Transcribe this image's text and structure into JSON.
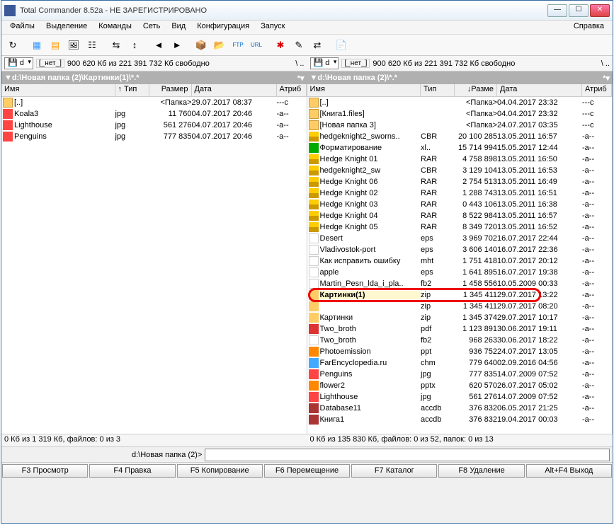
{
  "title": "Total Commander 8.52a - НЕ ЗАРЕГИСТРИРОВАНО",
  "menu": [
    "Файлы",
    "Выделение",
    "Команды",
    "Сеть",
    "Вид",
    "Конфигурация",
    "Запуск"
  ],
  "menu_right": "Справка",
  "drive": {
    "left": {
      "sel": "d",
      "label": "[_нет_]",
      "space": "900 620 Кб из 221 391 732 Кб свободно",
      "nav": "\\  ..",
      "path": "▼d:\\Новая папка (2)\\Картинки(1)\\*.*"
    },
    "right": {
      "sel": "d",
      "label": "[_нет_]",
      "space": "900 620 Кб из 221 391 732 Кб свободно",
      "nav": "\\  ..",
      "path": "▼d:\\Новая папка (2)\\*.*"
    }
  },
  "colhdr": {
    "name": "Имя",
    "type": "↑ Тип",
    "size": "Размер",
    "date": "Дата",
    "attr": "Атриб"
  },
  "colhdr_r": {
    "name": "Имя",
    "type": "Тип",
    "size": "↓Разме",
    "date": "Дата",
    "attr": "Атриб"
  },
  "left_rows": [
    {
      "ic": "folder",
      "nm": "[..]",
      "tp": "",
      "sz": "<Папка>",
      "dt": "29.07.2017 08:37",
      "at": "---c"
    },
    {
      "ic": "jpg",
      "nm": "Koala3",
      "tp": "jpg",
      "sz": "11 760",
      "dt": "04.07.2017 20:46",
      "at": "-a--"
    },
    {
      "ic": "jpg",
      "nm": "Lighthouse",
      "tp": "jpg",
      "sz": "561 276",
      "dt": "04.07.2017 20:46",
      "at": "-a--"
    },
    {
      "ic": "jpg",
      "nm": "Penguins",
      "tp": "jpg",
      "sz": "777 835",
      "dt": "04.07.2017 20:46",
      "at": "-a--"
    }
  ],
  "right_rows": [
    {
      "ic": "folder",
      "nm": "[..]",
      "tp": "",
      "sz": "<Папка>",
      "dt": "04.04.2017 23:32",
      "at": "---c"
    },
    {
      "ic": "folder",
      "nm": "[Книга1.files]",
      "tp": "",
      "sz": "<Папка>",
      "dt": "04.04.2017 23:32",
      "at": "---c"
    },
    {
      "ic": "folder",
      "nm": "[Новая папка 3]",
      "tp": "",
      "sz": "<Папка>",
      "dt": "24.07.2017 03:35",
      "at": "---c"
    },
    {
      "ic": "cbr",
      "nm": "hedgeknight2_sworns..",
      "tp": "CBR",
      "sz": "20 100 285",
      "dt": "13.05.2011 16:57",
      "at": "-a--"
    },
    {
      "ic": "xl",
      "nm": "Форматирование",
      "tp": "xl..",
      "sz": "15 714 994",
      "dt": "15.05.2017 12:44",
      "at": "-a--"
    },
    {
      "ic": "rar",
      "nm": "Hedge Knight 01",
      "tp": "RAR",
      "sz": "4 758 898",
      "dt": "13.05.2011 16:50",
      "at": "-a--"
    },
    {
      "ic": "cbr",
      "nm": "hedgeknight2_sw",
      "tp": "CBR",
      "sz": "3 129 104",
      "dt": "13.05.2011 16:53",
      "at": "-a--"
    },
    {
      "ic": "rar",
      "nm": "Hedge Knight 06",
      "tp": "RAR",
      "sz": "2 754 513",
      "dt": "13.05.2011 16:49",
      "at": "-a--"
    },
    {
      "ic": "rar",
      "nm": "Hedge Knight 02",
      "tp": "RAR",
      "sz": "1 288 743",
      "dt": "13.05.2011 16:51",
      "at": "-a--"
    },
    {
      "ic": "rar",
      "nm": "Hedge Knight 03",
      "tp": "RAR",
      "sz": "0 443 106",
      "dt": "13.05.2011 16:38",
      "at": "-a--"
    },
    {
      "ic": "rar",
      "nm": "Hedge Knight 04",
      "tp": "RAR",
      "sz": "8 522 984",
      "dt": "13.05.2011 16:57",
      "at": "-a--"
    },
    {
      "ic": "rar",
      "nm": "Hedge Knight 05",
      "tp": "RAR",
      "sz": "8 349 720",
      "dt": "13.05.2011 16:52",
      "at": "-a--"
    },
    {
      "ic": "eps",
      "nm": "Desert",
      "tp": "eps",
      "sz": "3 969 702",
      "dt": "16.07.2017 22:44",
      "at": "-a--"
    },
    {
      "ic": "eps",
      "nm": "Vladivostok-port",
      "tp": "eps",
      "sz": "3 606 140",
      "dt": "16.07.2017 22:36",
      "at": "-a--"
    },
    {
      "ic": "mht",
      "nm": "Как исправить ошибку",
      "tp": "mht",
      "sz": "1 751 418",
      "dt": "10.07.2017 20:12",
      "at": "-a--"
    },
    {
      "ic": "eps",
      "nm": "apple",
      "tp": "eps",
      "sz": "1 641 895",
      "dt": "16.07.2017 19:38",
      "at": "-a--"
    },
    {
      "ic": "fb2",
      "nm": "Martin_Pesn_lda_i_pla..",
      "tp": "fb2",
      "sz": "1 458 556",
      "dt": "10.05.2009 00:33",
      "at": "-a--"
    },
    {
      "ic": "zip",
      "nm": "Картинки(1)",
      "tp": "zip",
      "sz": "1 345 411",
      "dt": "29.07.2017 13:22",
      "at": "-a--",
      "hl": true
    },
    {
      "ic": "zip",
      "nm": "",
      "tp": "zip",
      "sz": "1 345 411",
      "dt": "29.07.2017 08:20",
      "at": "-a--"
    },
    {
      "ic": "zip",
      "nm": "Картинки",
      "tp": "zip",
      "sz": "1 345 374",
      "dt": "29.07.2017 10:17",
      "at": "-a--"
    },
    {
      "ic": "pdf",
      "nm": "Two_broth",
      "tp": "pdf",
      "sz": "1 123 891",
      "dt": "30.06.2017 19:11",
      "at": "-a--"
    },
    {
      "ic": "fb2",
      "nm": "Two_broth",
      "tp": "fb2",
      "sz": "968 263",
      "dt": "30.06.2017 18:22",
      "at": "-a--"
    },
    {
      "ic": "ppt",
      "nm": "Photoemission",
      "tp": "ppt",
      "sz": "936 752",
      "dt": "24.07.2017 13:05",
      "at": "-a--"
    },
    {
      "ic": "chm",
      "nm": "FarEncyclopedia.ru",
      "tp": "chm",
      "sz": "779 640",
      "dt": "02.09.2016 04:56",
      "at": "-a--"
    },
    {
      "ic": "jpg",
      "nm": "Penguins",
      "tp": "jpg",
      "sz": "777 835",
      "dt": "14.07.2009 07:52",
      "at": "-a--"
    },
    {
      "ic": "pptx",
      "nm": "flower2",
      "tp": "pptx",
      "sz": "620 570",
      "dt": "26.07.2017 05:02",
      "at": "-a--"
    },
    {
      "ic": "jpg",
      "nm": "Lighthouse",
      "tp": "jpg",
      "sz": "561 276",
      "dt": "14.07.2009 07:52",
      "at": "-a--"
    },
    {
      "ic": "accdb",
      "nm": "Database11",
      "tp": "accdb",
      "sz": "376 832",
      "dt": "06.05.2017 21:25",
      "at": "-a--"
    },
    {
      "ic": "accdb",
      "nm": "Книга1",
      "tp": "accdb",
      "sz": "376 832",
      "dt": "19.04.2017 00:03",
      "at": "-a--"
    }
  ],
  "status": {
    "left": "0 Кб из 1 319 Кб, файлов: 0 из 3",
    "right": "0 Кб из 135 830 Кб, файлов: 0 из 52, папок: 0 из 13"
  },
  "cmd_prompt": "d:\\Новая папка (2)>",
  "fkeys": [
    "F3 Просмотр",
    "F4 Правка",
    "F5 Копирование",
    "F6 Перемещение",
    "F7 Каталог",
    "F8 Удаление",
    "Alt+F4 Выход"
  ]
}
